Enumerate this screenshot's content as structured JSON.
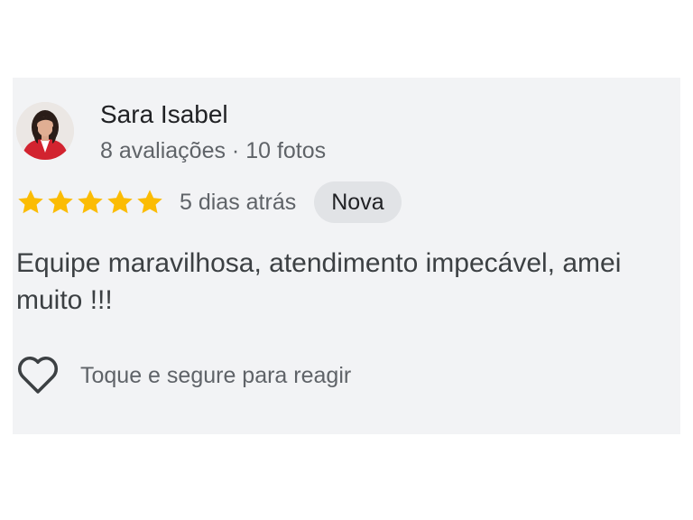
{
  "reviewer": {
    "name": "Sara Isabel",
    "meta": "8 avaliações · 10 fotos",
    "avatar_icon": "user-avatar-photo"
  },
  "rating": {
    "stars": 5,
    "max_stars": 5,
    "star_color": "#fbbc04",
    "time": "5 dias atrás",
    "badge": "Nova"
  },
  "review": {
    "text": "Equipe maravilhosa, atendimento impecável, amei muito !!!"
  },
  "reaction": {
    "icon": "heart-outline-icon",
    "label": "Toque e segure para reagir"
  }
}
